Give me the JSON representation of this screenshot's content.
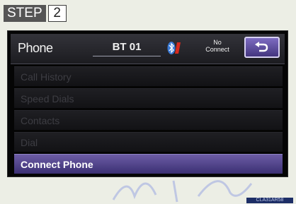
{
  "step": {
    "word": "STEP",
    "number": "2"
  },
  "header": {
    "title": "Phone",
    "device_name": "BT 01",
    "bluetooth_icon": "bluetooth-icon",
    "connection_status_line1": "No",
    "connection_status_line2": "Connect",
    "back_icon": "back-arrow-icon"
  },
  "menu": {
    "items": [
      {
        "label": "Call History",
        "enabled": false
      },
      {
        "label": "Speed Dials",
        "enabled": false
      },
      {
        "label": "Contacts",
        "enabled": false
      },
      {
        "label": "Dial",
        "enabled": false
      },
      {
        "label": "Connect Phone",
        "enabled": true
      }
    ]
  },
  "image_code": "CLA31AR58",
  "colors": {
    "accent": "#5a4a9a",
    "bluetooth": "#3b7bd6",
    "warning": "#d62b1f"
  }
}
